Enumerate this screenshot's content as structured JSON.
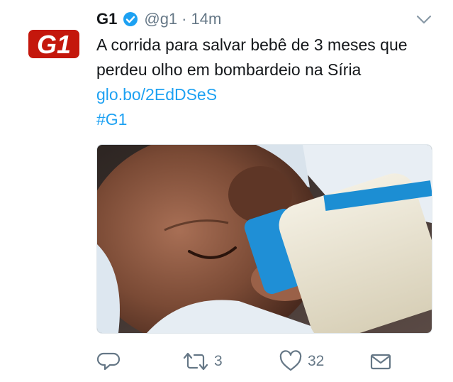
{
  "tweet": {
    "author_name": "G1",
    "handle": "@g1",
    "separator": "·",
    "timestamp": "14m",
    "avatar_text": "G1",
    "text_main": "A corrida para salvar bebê de 3 meses que perdeu olho em bombardeio na Síria",
    "link": "glo.bo/2EdDSeS",
    "hashtag": "#G1"
  },
  "actions": {
    "retweet_count": "3",
    "like_count": "32"
  },
  "colors": {
    "brand_red": "#c4170c",
    "link_blue": "#1da1f2",
    "muted_gray": "#657786",
    "verified_blue": "#1da1f2"
  },
  "icons": {
    "verified": "verified-badge-icon",
    "caret": "chevron-down-icon",
    "reply": "reply-icon",
    "retweet": "retweet-icon",
    "like": "heart-icon",
    "dm": "envelope-icon"
  }
}
